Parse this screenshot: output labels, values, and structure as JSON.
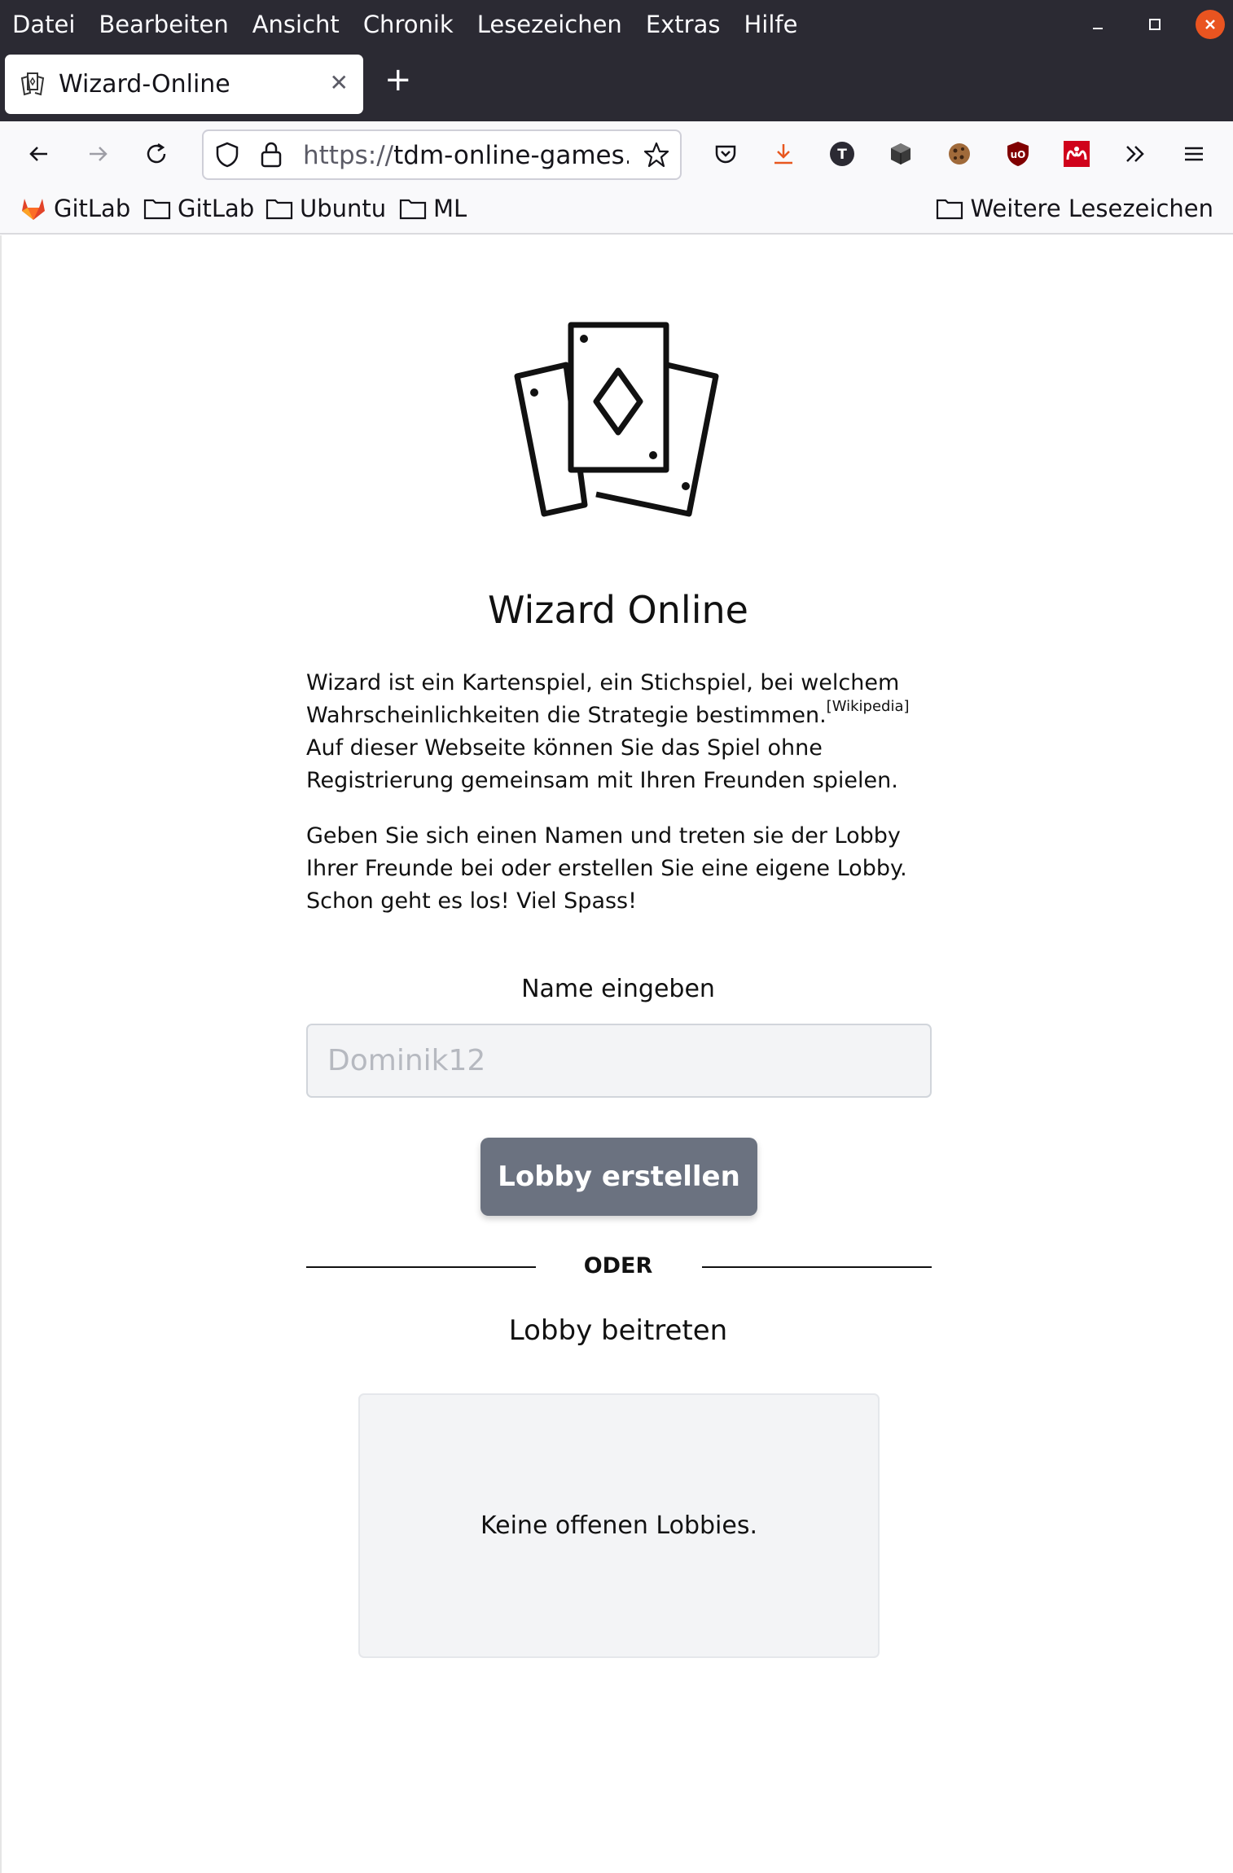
{
  "menubar": {
    "items": [
      "Datei",
      "Bearbeiten",
      "Ansicht",
      "Chronik",
      "Lesezeichen",
      "Extras",
      "Hilfe"
    ]
  },
  "tab": {
    "title": "Wizard-Online"
  },
  "urlbar": {
    "scheme": "https://",
    "host": "tdm-online-games.he"
  },
  "bookmarks": {
    "items": [
      "GitLab",
      "GitLab",
      "Ubuntu",
      "ML"
    ],
    "other": "Weitere Lesezeichen"
  },
  "toolbar_icons": [
    "pocket-icon",
    "download-icon",
    "extension-t-icon",
    "extension-cube-icon",
    "cookie-icon",
    "ublock-icon",
    "mendeley-icon",
    "overflow-icon",
    "menu-icon"
  ],
  "page": {
    "title": "Wizard Online",
    "intro_part1": "Wizard ist ein Kartenspiel, ein Stichspiel, bei welchem Wahrscheinlichkeiten die Strategie bestimmen.",
    "intro_ref": "[Wikipedia]",
    "intro_part2": " Auf dieser Webseite können Sie das Spiel ohne Registrierung gemeinsam mit Ihren Freunden spielen.",
    "instructions": "Geben Sie sich einen Namen und treten sie der Lobby Ihrer Freunde bei oder erstellen Sie eine eigene Lobby. Schon geht es los! Viel Spass!",
    "name_label": "Name eingeben",
    "name_placeholder": "Dominik12",
    "create_button": "Lobby erstellen",
    "divider": "ODER",
    "join_label": "Lobby beitreten",
    "no_lobbies": "Keine offenen Lobbies."
  },
  "colors": {
    "chrome_dark": "#2b2a33",
    "toolbar_bg": "#f9f9fb",
    "button_gray": "#6b7280",
    "close_orange": "#e95420",
    "download_orange": "#e8571f",
    "ublock_red": "#800000",
    "mendeley_red": "#d0021b"
  }
}
